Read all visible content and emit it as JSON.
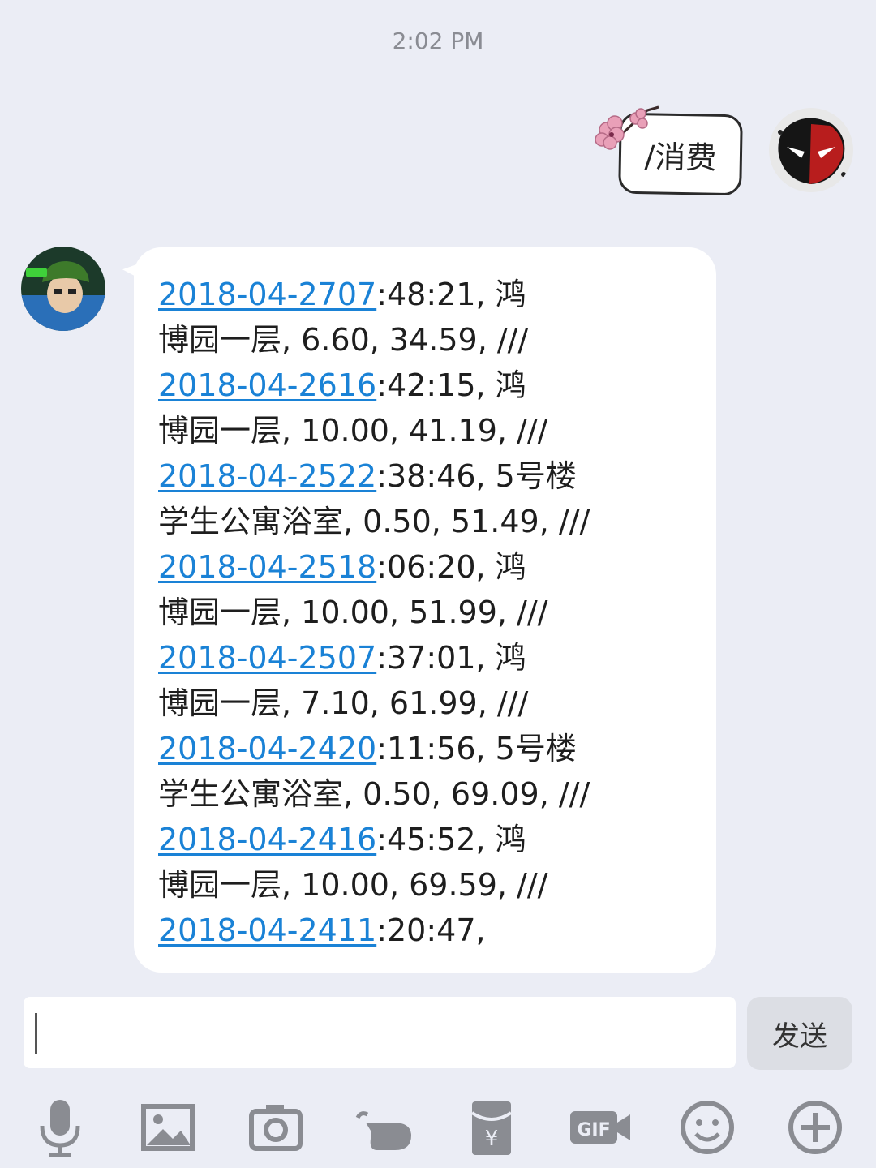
{
  "timestamp": "2:02 PM",
  "outgoing": {
    "text": "/消费"
  },
  "incoming": {
    "lines": [
      {
        "link": "2018-04-2707",
        "rest": ":48:21, 鸿"
      },
      {
        "link": "",
        "rest": "博园一层, 6.60, 34.59, ///"
      },
      {
        "link": "2018-04-2616",
        "rest": ":42:15, 鸿"
      },
      {
        "link": "",
        "rest": "博园一层, 10.00, 41.19, ///"
      },
      {
        "link": "2018-04-2522",
        "rest": ":38:46, 5号楼"
      },
      {
        "link": "",
        "rest": "学生公寓浴室, 0.50, 51.49, ///"
      },
      {
        "link": "2018-04-2518",
        "rest": ":06:20, 鸿"
      },
      {
        "link": "",
        "rest": "博园一层, 10.00, 51.99, ///"
      },
      {
        "link": "2018-04-2507",
        "rest": ":37:01, 鸿"
      },
      {
        "link": "",
        "rest": "博园一层, 7.10, 61.99, ///"
      },
      {
        "link": "2018-04-2420",
        "rest": ":11:56, 5号楼"
      },
      {
        "link": "",
        "rest": "学生公寓浴室, 0.50, 69.09, ///"
      },
      {
        "link": "2018-04-2416",
        "rest": ":45:52, 鸿"
      },
      {
        "link": "",
        "rest": "博园一层, 10.00, 69.59, ///"
      },
      {
        "link": "2018-04-2411",
        "rest": ":20:47,"
      }
    ]
  },
  "input": {
    "value": ""
  },
  "send_label": "发送",
  "toolbar": [
    "microphone-icon",
    "image-icon",
    "camera-icon",
    "poke-icon",
    "red-packet-icon",
    "gif-icon",
    "emoji-icon",
    "plus-icon"
  ],
  "colors": {
    "background": "#ebedf5",
    "link": "#1a82d6",
    "bubble": "#ffffff"
  }
}
